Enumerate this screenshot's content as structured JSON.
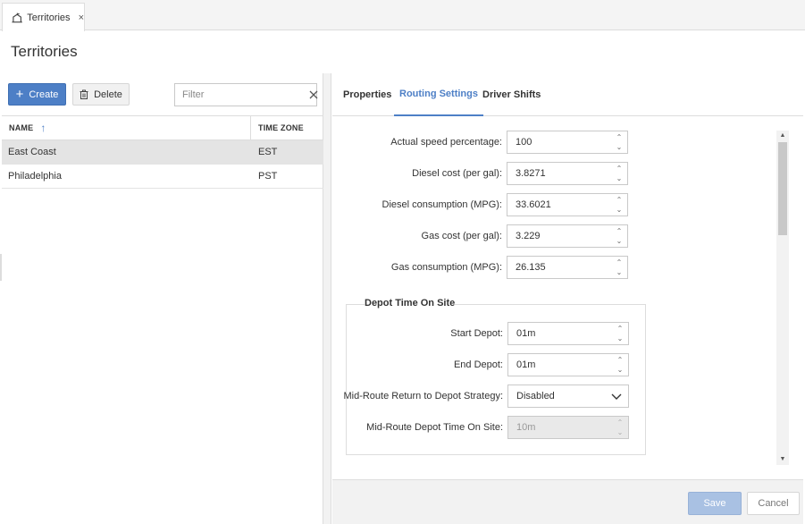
{
  "document_tab": {
    "label": "Territories",
    "icon": "territory-icon",
    "close_glyph": "×"
  },
  "page": {
    "title": "Territories"
  },
  "toolbar": {
    "create_label": "Create",
    "delete_label": "Delete",
    "filter_placeholder": "Filter",
    "filter_value": ""
  },
  "grid": {
    "columns": [
      {
        "label": "NAME",
        "sorted": "ascending"
      },
      {
        "label": "TIME ZONE"
      }
    ],
    "rows": [
      {
        "name": "East Coast",
        "time_zone": "EST",
        "selected": true
      },
      {
        "name": "Philadelphia",
        "time_zone": "PST",
        "selected": false
      }
    ]
  },
  "detail_tabs": [
    {
      "label": "Properties",
      "active": false
    },
    {
      "label": "Routing Settings",
      "active": true
    },
    {
      "label": "Driver Shifts",
      "active": false
    }
  ],
  "routing": {
    "fields": [
      {
        "label": "Actual speed percentage:",
        "value": "100"
      },
      {
        "label": "Diesel cost (per gal):",
        "value": "3.8271"
      },
      {
        "label": "Diesel consumption (MPG):",
        "value": "33.6021"
      },
      {
        "label": "Gas cost (per gal):",
        "value": "3.229"
      },
      {
        "label": "Gas consumption (MPG):",
        "value": "26.135"
      }
    ],
    "depot": {
      "title": "Depot Time On Site",
      "start_label": "Start Depot:",
      "start_value": "01m",
      "end_label": "End Depot:",
      "end_value": "01m",
      "strategy_label": "Mid-Route Return to Depot Strategy:",
      "strategy_value": "Disabled",
      "midroute_label": "Mid-Route Depot Time On Site:",
      "midroute_value": "10m",
      "midroute_disabled": true
    }
  },
  "footer": {
    "save_label": "Save",
    "cancel_label": "Cancel"
  },
  "colors": {
    "accent": "#4d7fc6",
    "selected_row": "#e4e4e4",
    "save_disabled": "#a9c1e3"
  }
}
